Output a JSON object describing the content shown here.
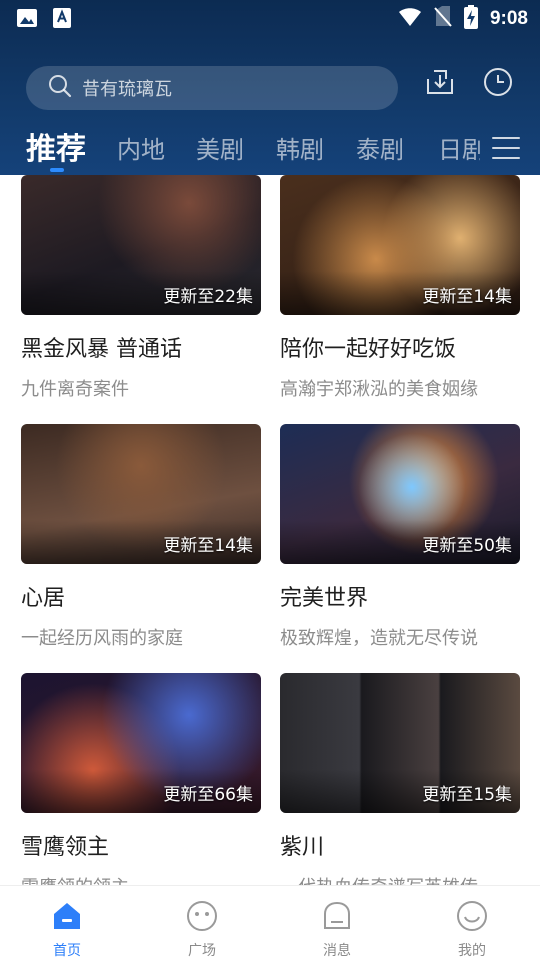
{
  "status_bar": {
    "time": "9:08",
    "icons": [
      "image-icon",
      "text-badge-icon",
      "wifi-icon",
      "no-sim-icon",
      "battery-charging-icon"
    ]
  },
  "header": {
    "search_placeholder": "昔有琉璃瓦",
    "download_icon": "download-icon",
    "history_icon": "clock-icon",
    "menu_icon": "menu-icon"
  },
  "tabs": [
    {
      "label": "推荐",
      "active": true
    },
    {
      "label": "内地",
      "active": false
    },
    {
      "label": "美剧",
      "active": false
    },
    {
      "label": "韩剧",
      "active": false
    },
    {
      "label": "泰剧",
      "active": false
    },
    {
      "label": "日剧",
      "active": false
    }
  ],
  "feed": {
    "cards": [
      {
        "title": "黑金风暴 普通话",
        "subtitle": "九件离奇案件",
        "badge": "更新至22集"
      },
      {
        "title": "陪你一起好好吃饭",
        "subtitle": "高瀚宇郑湫泓的美食姻缘",
        "badge": "更新至14集"
      },
      {
        "title": "心居",
        "subtitle": "一起经历风雨的家庭",
        "badge": "更新至14集"
      },
      {
        "title": "完美世界",
        "subtitle": "极致辉煌，造就无尽传说",
        "badge": "更新至50集"
      },
      {
        "title": "雪鹰领主",
        "subtitle": "雪鹰领的领主",
        "badge": "更新至66集"
      },
      {
        "title": "紫川",
        "subtitle": "一代热血传奇谱写英雄传",
        "badge": "更新至15集"
      }
    ]
  },
  "bottom_nav": [
    {
      "label": "首页",
      "icon": "home-icon",
      "active": true
    },
    {
      "label": "广场",
      "icon": "square-icon",
      "active": false
    },
    {
      "label": "消息",
      "icon": "message-icon",
      "active": false
    },
    {
      "label": "我的",
      "icon": "profile-icon",
      "active": false
    }
  ],
  "colors": {
    "header_bg": "#123a6a",
    "accent": "#2d7ff9",
    "active_indicator": "#2d8cff"
  }
}
